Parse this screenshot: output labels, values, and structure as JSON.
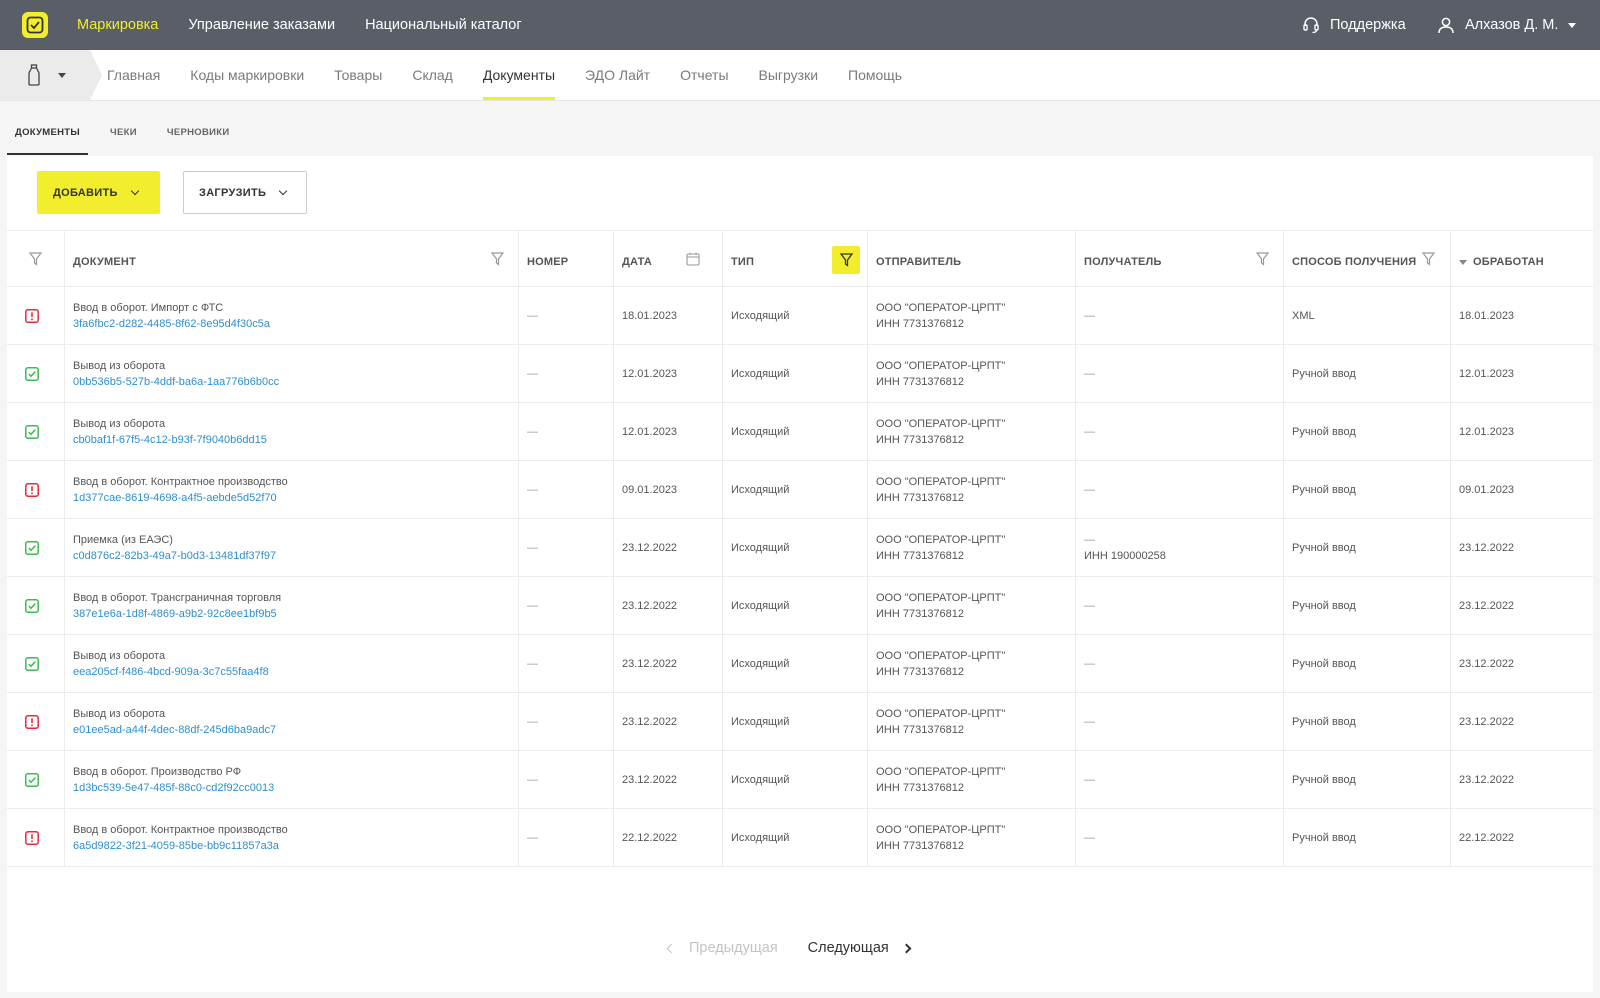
{
  "topbar": {
    "nav": [
      "Маркировка",
      "Управление заказами",
      "Национальный каталог"
    ],
    "support": "Поддержка",
    "user": "Алхазов Д. М."
  },
  "mainnav": [
    "Главная",
    "Коды маркировки",
    "Товары",
    "Склад",
    "Документы",
    "ЭДО Лайт",
    "Отчеты",
    "Выгрузки",
    "Помощь"
  ],
  "tabs": [
    "ДОКУМЕНТЫ",
    "ЧЕКИ",
    "ЧЕРНОВИКИ"
  ],
  "toolbar": {
    "add": "ДОБАВИТЬ",
    "load": "ЗАГРУЗИТЬ"
  },
  "columns": [
    "ДОКУМЕНТ",
    "НОМЕР",
    "ДАТА",
    "ТИП",
    "ОТПРАВИТЕЛЬ",
    "ПОЛУЧАТЕЛЬ",
    "СПОСОБ ПОЛУЧЕНИЯ",
    "ОБРАБОТАН"
  ],
  "rows": [
    {
      "status": "error",
      "title": "Ввод в оборот. Импорт с ФТС",
      "id": "3fa6fbc2-d282-4485-8f62-8e95d4f30c5a",
      "number": "—",
      "date": "18.01.2023",
      "type": "Исходящий",
      "sender": "ООО \"ОПЕРАТОР-ЦРПТ\"",
      "sender_inn": "ИНН 7731376812",
      "recipient": "—",
      "recipient_inn": "",
      "method": "XML",
      "processed": "18.01.2023"
    },
    {
      "status": "ok",
      "title": "Вывод из оборота",
      "id": "0bb536b5-527b-4ddf-ba6a-1aa776b6b0cc",
      "number": "—",
      "date": "12.01.2023",
      "type": "Исходящий",
      "sender": "ООО \"ОПЕРАТОР-ЦРПТ\"",
      "sender_inn": "ИНН 7731376812",
      "recipient": "—",
      "recipient_inn": "",
      "method": "Ручной ввод",
      "processed": "12.01.2023"
    },
    {
      "status": "ok",
      "title": "Вывод из оборота",
      "id": "cb0baf1f-67f5-4c12-b93f-7f9040b6dd15",
      "number": "—",
      "date": "12.01.2023",
      "type": "Исходящий",
      "sender": "ООО \"ОПЕРАТОР-ЦРПТ\"",
      "sender_inn": "ИНН 7731376812",
      "recipient": "—",
      "recipient_inn": "",
      "method": "Ручной ввод",
      "processed": "12.01.2023"
    },
    {
      "status": "error",
      "title": "Ввод в оборот. Контрактное производство",
      "id": "1d377cae-8619-4698-a4f5-aebde5d52f70",
      "number": "—",
      "date": "09.01.2023",
      "type": "Исходящий",
      "sender": "ООО \"ОПЕРАТОР-ЦРПТ\"",
      "sender_inn": "ИНН 7731376812",
      "recipient": "—",
      "recipient_inn": "",
      "method": "Ручной ввод",
      "processed": "09.01.2023"
    },
    {
      "status": "ok",
      "title": "Приемка (из ЕАЭС)",
      "id": "c0d876c2-82b3-49a7-b0d3-13481df37f97",
      "number": "—",
      "date": "23.12.2022",
      "type": "Исходящий",
      "sender": "ООО \"ОПЕРАТОР-ЦРПТ\"",
      "sender_inn": "ИНН 7731376812",
      "recipient": "—",
      "recipient_inn": "ИНН 190000258",
      "method": "Ручной ввод",
      "processed": "23.12.2022"
    },
    {
      "status": "ok",
      "title": "Ввод в оборот. Трансграничная торговля",
      "id": "387e1e6a-1d8f-4869-a9b2-92c8ee1bf9b5",
      "number": "—",
      "date": "23.12.2022",
      "type": "Исходящий",
      "sender": "ООО \"ОПЕРАТОР-ЦРПТ\"",
      "sender_inn": "ИНН 7731376812",
      "recipient": "—",
      "recipient_inn": "",
      "method": "Ручной ввод",
      "processed": "23.12.2022"
    },
    {
      "status": "ok",
      "title": "Вывод из оборота",
      "id": "eea205cf-f486-4bcd-909a-3c7c55faa4f8",
      "number": "—",
      "date": "23.12.2022",
      "type": "Исходящий",
      "sender": "ООО \"ОПЕРАТОР-ЦРПТ\"",
      "sender_inn": "ИНН 7731376812",
      "recipient": "—",
      "recipient_inn": "",
      "method": "Ручной ввод",
      "processed": "23.12.2022"
    },
    {
      "status": "error",
      "title": "Вывод из оборота",
      "id": "e01ee5ad-a44f-4dec-88df-245d6ba9adc7",
      "number": "—",
      "date": "23.12.2022",
      "type": "Исходящий",
      "sender": "ООО \"ОПЕРАТОР-ЦРПТ\"",
      "sender_inn": "ИНН 7731376812",
      "recipient": "—",
      "recipient_inn": "",
      "method": "Ручной ввод",
      "processed": "23.12.2022"
    },
    {
      "status": "ok",
      "title": "Ввод в оборот. Производство РФ",
      "id": "1d3bc539-5e47-485f-88c0-cd2f92cc0013",
      "number": "—",
      "date": "23.12.2022",
      "type": "Исходящий",
      "sender": "ООО \"ОПЕРАТОР-ЦРПТ\"",
      "sender_inn": "ИНН 7731376812",
      "recipient": "—",
      "recipient_inn": "",
      "method": "Ручной ввод",
      "processed": "23.12.2022"
    },
    {
      "status": "error",
      "title": "Ввод в оборот. Контрактное производство",
      "id": "6a5d9822-3f21-4059-85be-bb9c11857a3a",
      "number": "—",
      "date": "22.12.2022",
      "type": "Исходящий",
      "sender": "ООО \"ОПЕРАТОР-ЦРПТ\"",
      "sender_inn": "ИНН 7731376812",
      "recipient": "—",
      "recipient_inn": "",
      "method": "Ручной ввод",
      "processed": "22.12.2022"
    }
  ],
  "pager": {
    "prev": "Предыдущая",
    "next": "Следующая"
  },
  "colors": {
    "accent": "#f3ee2d",
    "topbar": "#5a5e66",
    "link": "#2d8ecf",
    "ok": "#3dbb50",
    "error": "#e52b3c"
  }
}
